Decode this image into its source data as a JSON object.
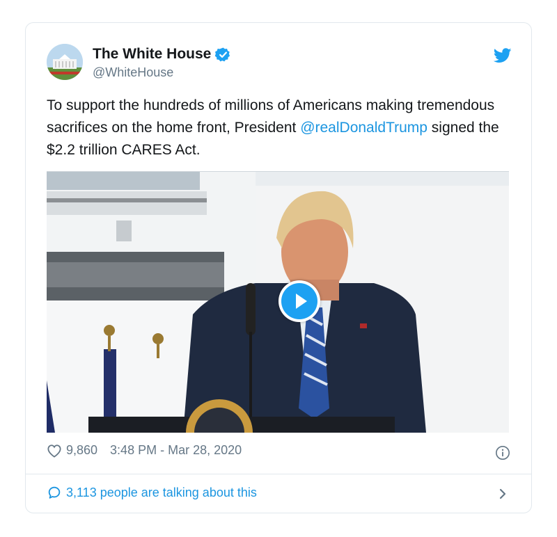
{
  "tweet": {
    "author_name": "The White House",
    "author_handle": "@WhiteHouse",
    "text_before": "To support the hundreds of millions of Americans making tremendous sacrifices on the home front, President ",
    "mention": "@realDonaldTrump",
    "text_after": " signed the $2.2 trillion CARES Act.",
    "likes": "9,860",
    "timestamp": "3:48 PM - Mar 28, 2020",
    "talking": "3,113 people are talking about this"
  },
  "icons": {
    "verified": "verified-badge-icon",
    "brand": "twitter-bird-icon",
    "like": "heart-icon",
    "info": "info-icon",
    "reply": "speech-bubble-icon",
    "chevron": "chevron-right-icon",
    "play": "play-icon"
  },
  "colors": {
    "accent": "#1da1f2",
    "link": "#1b95e0",
    "secondary_text": "#657786",
    "border": "#e1e8ed"
  }
}
